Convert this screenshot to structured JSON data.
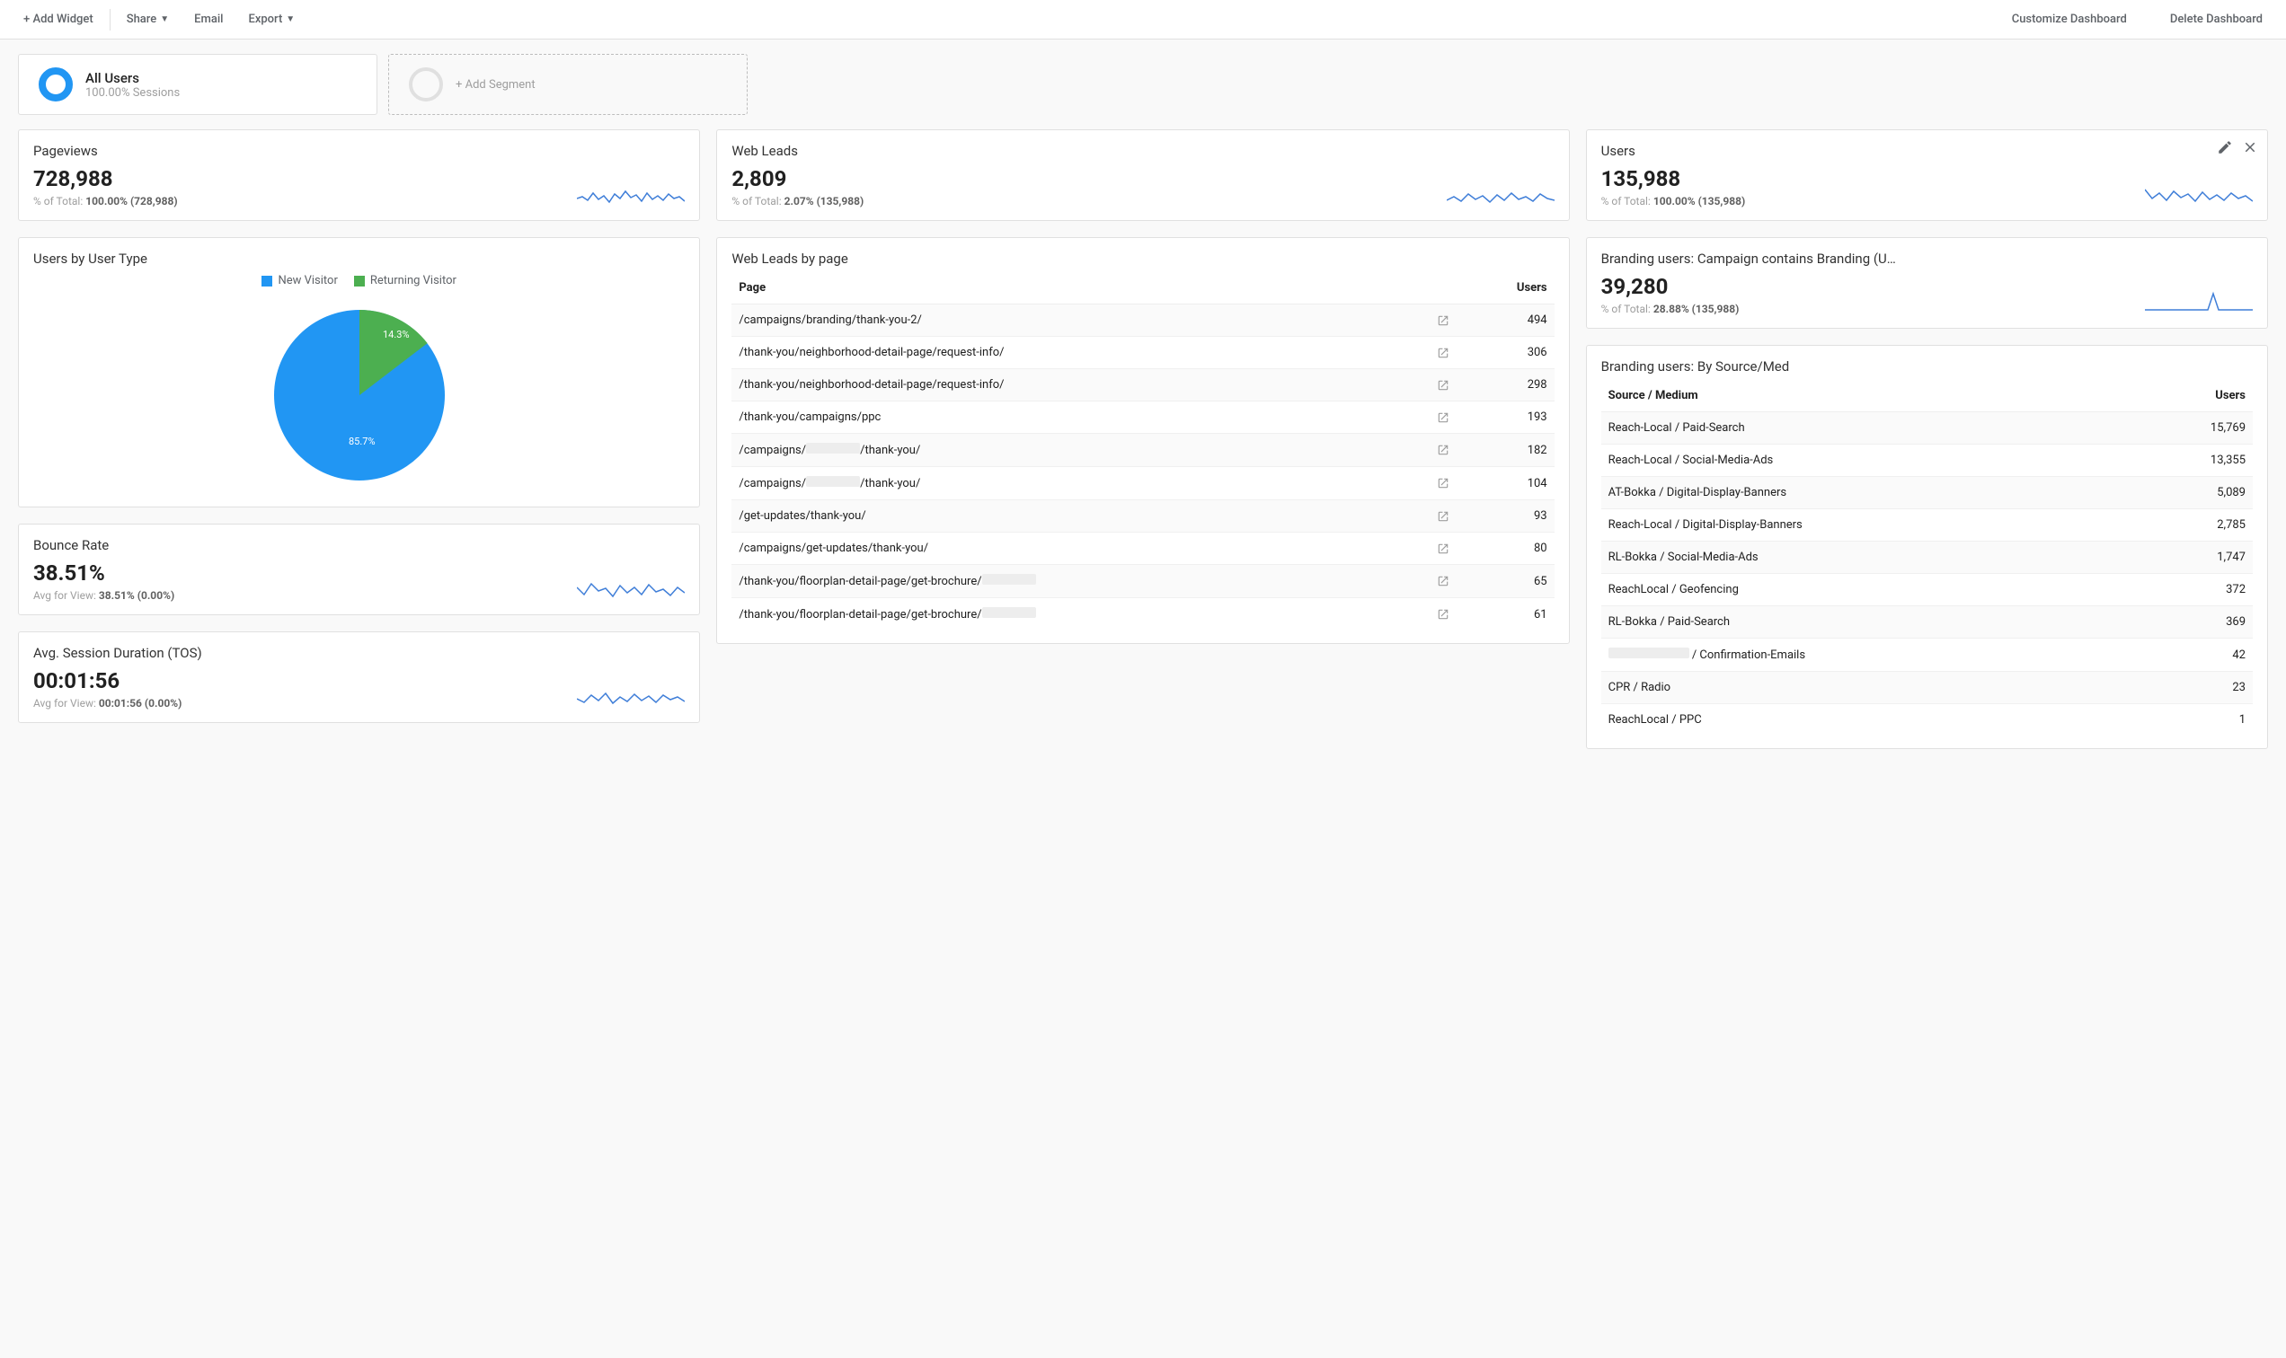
{
  "toolbar": {
    "add_widget": "+ Add Widget",
    "share": "Share",
    "email": "Email",
    "export": "Export",
    "customize": "Customize Dashboard",
    "delete": "Delete Dashboard"
  },
  "segments": {
    "active": {
      "title": "All Users",
      "sub": "100.00% Sessions"
    },
    "add_label": "+ Add Segment"
  },
  "pageviews": {
    "title": "Pageviews",
    "value": "728,988",
    "sub_prefix": "% of Total: ",
    "sub_bold": "100.00% (728,988)"
  },
  "webleads": {
    "title": "Web Leads",
    "value": "2,809",
    "sub_prefix": "% of Total: ",
    "sub_bold": "2.07% (135,988)"
  },
  "users": {
    "title": "Users",
    "value": "135,988",
    "sub_prefix": "% of Total: ",
    "sub_bold": "100.00% (135,988)"
  },
  "usertype": {
    "title": "Users by User Type",
    "legend_new": "New Visitor",
    "legend_return": "Returning Visitor",
    "slice_new_label": "85.7%",
    "slice_return_label": "14.3%"
  },
  "bounce": {
    "title": "Bounce Rate",
    "value": "38.51%",
    "sub_prefix": "Avg for View: ",
    "sub_bold": "38.51% (0.00%)"
  },
  "avgsession": {
    "title": "Avg. Session Duration (TOS)",
    "value": "00:01:56",
    "sub_prefix": "Avg for View: ",
    "sub_bold": "00:01:56 (0.00%)"
  },
  "leads_by_page": {
    "title": "Web Leads by page",
    "col_page": "Page",
    "col_users": "Users",
    "rows": [
      {
        "page": "/campaigns/branding/thank-you-2/",
        "users": "494"
      },
      {
        "page": "/thank-you/neighborhood-detail-page/request-info/",
        "users": "306"
      },
      {
        "page": "/thank-you/neighborhood-detail-page/request-info/",
        "users": "298"
      },
      {
        "page": "/thank-you/campaigns/ppc",
        "users": "193"
      },
      {
        "page": "/campaigns/▮▮▮▮/thank-you/",
        "users": "182"
      },
      {
        "page": "/campaigns/▮▮▮▮/thank-you/",
        "users": "104"
      },
      {
        "page": "/get-updates/thank-you/",
        "users": "93"
      },
      {
        "page": "/campaigns/get-updates/thank-you/",
        "users": "80"
      },
      {
        "page": "/thank-you/floorplan-detail-page/get-brochure/▮▮▮",
        "users": "65"
      },
      {
        "page": "/thank-you/floorplan-detail-page/get-brochure/▮▮▮",
        "users": "61"
      }
    ]
  },
  "branding_metric": {
    "title": "Branding users: Campaign contains Branding (U…",
    "value": "39,280",
    "sub_prefix": "% of Total: ",
    "sub_bold": "28.88% (135,988)"
  },
  "branding_source": {
    "title": "Branding users: By Source/Med",
    "col_source": "Source / Medium",
    "col_users": "Users",
    "rows": [
      {
        "source": "Reach-Local / Paid-Search",
        "users": "15,769"
      },
      {
        "source": "Reach-Local / Social-Media-Ads",
        "users": "13,355"
      },
      {
        "source": "AT-Bokka / Digital-Display-Banners",
        "users": "5,089"
      },
      {
        "source": "Reach-Local / Digital-Display-Banners",
        "users": "2,785"
      },
      {
        "source": "RL-Bokka / Social-Media-Ads",
        "users": "1,747"
      },
      {
        "source": "ReachLocal / Geofencing",
        "users": "372"
      },
      {
        "source": "RL-Bokka / Paid-Search",
        "users": "369"
      },
      {
        "source": "▮▮▮▮▮▮ / Confirmation-Emails",
        "users": "42"
      },
      {
        "source": "CPR / Radio",
        "users": "23"
      },
      {
        "source": "ReachLocal / PPC",
        "users": "1"
      }
    ]
  },
  "colors": {
    "blue": "#2196f3",
    "green": "#4caf50",
    "spark": "#3f7ed8"
  },
  "chart_data": {
    "type": "pie",
    "title": "Users by User Type",
    "series": [
      {
        "name": "New Visitor",
        "value": 85.7,
        "color": "#2196f3"
      },
      {
        "name": "Returning Visitor",
        "value": 14.3,
        "color": "#4caf50"
      }
    ]
  }
}
